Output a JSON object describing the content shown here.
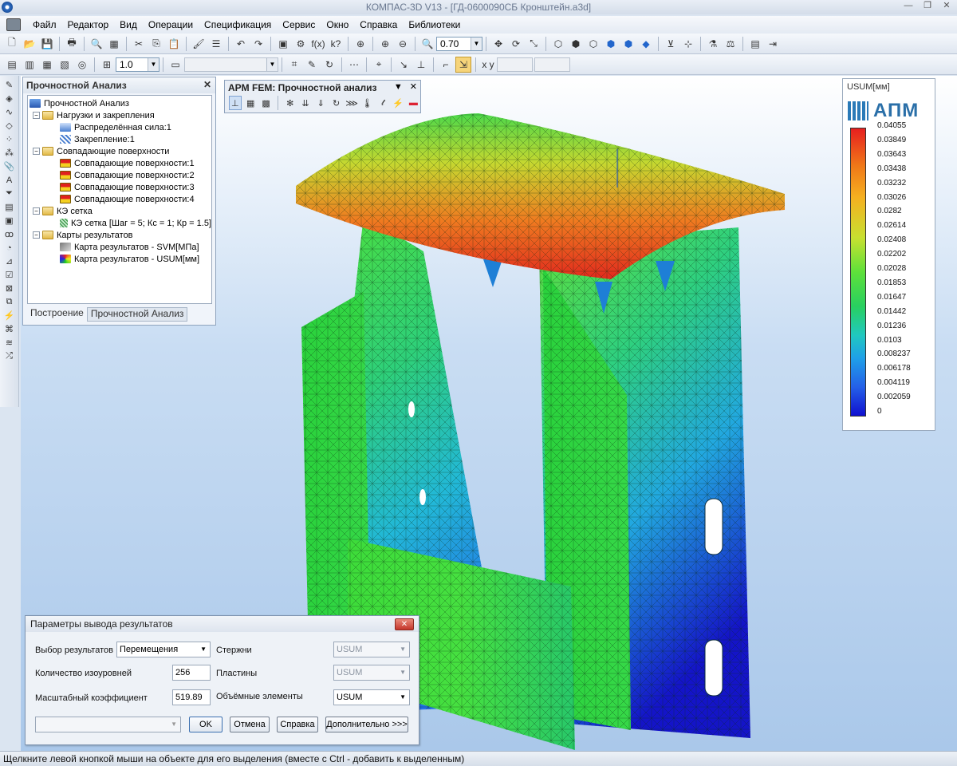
{
  "window": {
    "title": "КОМПАС-3D V13 - [ГД-0600090СБ Кронштейн.a3d]"
  },
  "menu": [
    "Файл",
    "Редактор",
    "Вид",
    "Операции",
    "Спецификация",
    "Сервис",
    "Окно",
    "Справка",
    "Библиотеки"
  ],
  "toolbar": {
    "zoom_value": "0.70",
    "step_value": "1.0"
  },
  "tree_panel": {
    "title": "Прочностной Анализ",
    "items": [
      {
        "label": "Прочностной Анализ",
        "level": 0,
        "icon": "analysis-icon"
      },
      {
        "label": "Нагрузки и закрепления",
        "level": 1,
        "icon": "folder-icon",
        "expand": "−"
      },
      {
        "label": "Распределённая сила:1",
        "level": 2,
        "icon": "force-icon"
      },
      {
        "label": "Закрепление:1",
        "level": 2,
        "icon": "fixture-icon"
      },
      {
        "label": "Совпадающие поверхности",
        "level": 1,
        "icon": "folder-icon",
        "expand": "−"
      },
      {
        "label": "Совпадающие поверхности:1",
        "level": 2,
        "icon": "surface-icon"
      },
      {
        "label": "Совпадающие поверхности:2",
        "level": 2,
        "icon": "surface-icon"
      },
      {
        "label": "Совпадающие поверхности:3",
        "level": 2,
        "icon": "surface-icon"
      },
      {
        "label": "Совпадающие поверхности:4",
        "level": 2,
        "icon": "surface-icon"
      },
      {
        "label": "КЭ сетка",
        "level": 1,
        "icon": "folder-icon",
        "expand": "−"
      },
      {
        "label": "КЭ сетка [Шаг = 5; Кс = 1; Кр = 1.5]",
        "level": 2,
        "icon": "mesh-icon"
      },
      {
        "label": "Карты результатов",
        "level": 1,
        "icon": "folder-icon",
        "expand": "−"
      },
      {
        "label": "Карта результатов - SVM[МПа]",
        "level": 2,
        "icon": "result-map-icon"
      },
      {
        "label": "Карта результатов - USUM[мм]",
        "level": 2,
        "icon": "result-map-color-icon"
      }
    ],
    "tabs": [
      "Построение",
      "Прочностной Анализ"
    ]
  },
  "fem_toolbar": {
    "title": "APM FEM: Прочностной анализ"
  },
  "legend": {
    "title": "USUM[мм]",
    "logo_text": "АПМ",
    "values": [
      "0.04055",
      "0.03849",
      "0.03643",
      "0.03438",
      "0.03232",
      "0.03026",
      "0.0282",
      "0.02614",
      "0.02408",
      "0.02202",
      "0.02028",
      "0.01853",
      "0.01647",
      "0.01442",
      "0.01236",
      "0.0103",
      "0.008237",
      "0.006178",
      "0.004119",
      "0.002059",
      "0"
    ]
  },
  "dialog": {
    "title": "Параметры вывода результатов",
    "result_select_label": "Выбор результатов",
    "result_select_value": "Перемещения",
    "isolevels_label": "Количество изоуровней",
    "isolevels_value": "256",
    "scale_label": "Масштабный коэффициент",
    "scale_value": "519.89",
    "rods_label": "Стержни",
    "rods_value": "USUM",
    "plates_label": "Пластины",
    "plates_value": "USUM",
    "solids_label": "Объёмные элементы",
    "solids_value": "USUM",
    "ok": "OK",
    "cancel": "Отмена",
    "help": "Справка",
    "more": "Дополнительно >>>"
  },
  "status": "Щелкните левой кнопкой мыши на объекте для его выделения (вместе с Ctrl - добавить к выделенным)"
}
